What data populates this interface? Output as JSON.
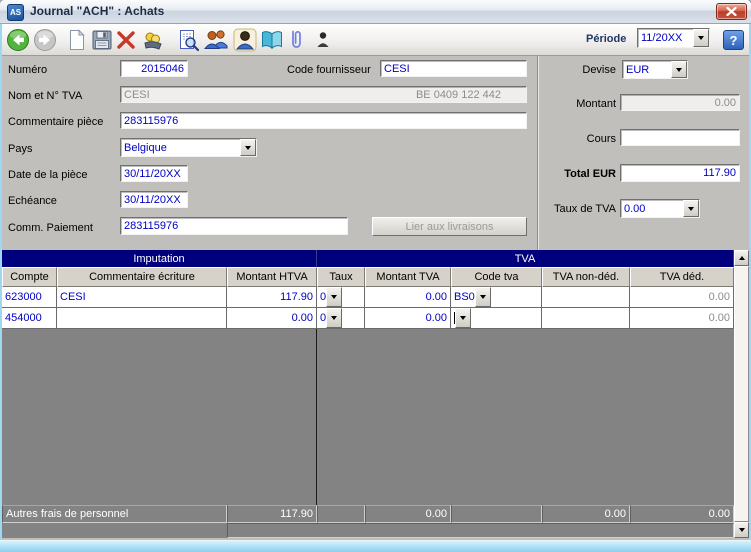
{
  "window": {
    "title": "Journal \"ACH\" : Achats",
    "app_icon_text": "AS"
  },
  "toolbar": {
    "icon_names": [
      "back",
      "forward",
      "new-document",
      "save",
      "delete",
      "payment",
      "print-preview",
      "contacts",
      "contact-selected",
      "journal-book",
      "attachment",
      "person"
    ],
    "periode_label": "Période",
    "periode_value": "11/20XX",
    "help_label": "?"
  },
  "form": {
    "numero": {
      "label": "Numéro",
      "value": "2015046"
    },
    "code_fournisseur": {
      "label": "Code fournisseur",
      "value": "CESI"
    },
    "nom_tva": {
      "label": "Nom et N° TVA",
      "name": "CESI",
      "vat": "BE 0409 122 442"
    },
    "commentaire_piece": {
      "label": "Commentaire pièce",
      "value": "283115976"
    },
    "pays": {
      "label": "Pays",
      "value": "Belgique"
    },
    "date_piece": {
      "label": "Date de la pièce",
      "value": "30/11/20XX"
    },
    "echeance": {
      "label": "Echéance",
      "value": "30/11/20XX"
    },
    "comm_paiement": {
      "label": "Comm. Paiement",
      "value": "283115976"
    },
    "lier_button_label": "Lier aux livraisons",
    "devise": {
      "label": "Devise",
      "value": "EUR"
    },
    "montant": {
      "label": "Montant",
      "value": "0.00"
    },
    "cours": {
      "label": "Cours",
      "value": ""
    },
    "total_eur": {
      "label": "Total EUR",
      "value": "117.90"
    },
    "taux_tva": {
      "label": "Taux de TVA",
      "value": "0.00"
    }
  },
  "grid": {
    "group_imputation": "Imputation",
    "group_tva": "TVA",
    "columns": [
      "Compte",
      "Commentaire écriture",
      "Montant HTVA",
      "Taux",
      "Montant TVA",
      "Code tva",
      "TVA non-déd.",
      "TVA déd."
    ],
    "rows": [
      {
        "compte": "623000",
        "commentaire": "CESI",
        "montant_htva": "117.90",
        "taux": "0",
        "montant_tva": "0.00",
        "code_tva": "BS0",
        "tva_non_ded": "",
        "tva_ded": "0.00"
      },
      {
        "compte": "454000",
        "commentaire": "",
        "montant_htva": "0.00",
        "taux": "0",
        "montant_tva": "0.00",
        "code_tva": "",
        "tva_non_ded": "",
        "tva_ded": "0.00"
      }
    ],
    "summary": {
      "label": "Autres frais de personnel",
      "montant_htva": "117.90",
      "montant_tva": "0.00",
      "tva_non_ded": "0.00",
      "tva_ded": "0.00"
    }
  },
  "colors": {
    "accent_navy": "#00007d",
    "field_text_blue": "#0000c4",
    "grid_gray": "#838383",
    "frame_blue": "#9ed7f0",
    "close_red": "#b6402c"
  }
}
